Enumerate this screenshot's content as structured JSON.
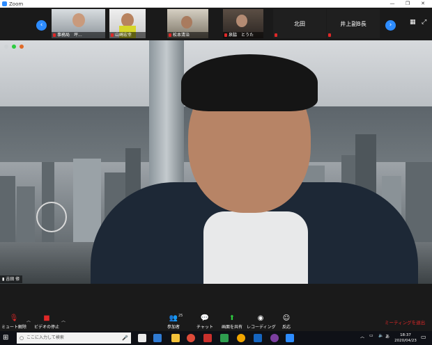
{
  "window": {
    "title": "Zoom"
  },
  "window_controls": {
    "minimize": "—",
    "maximize": "❐",
    "close": "✕"
  },
  "gallery": {
    "prev": "‹",
    "next": "›",
    "participants": [
      {
        "name": "事務局　坪..."
      },
      {
        "name": "山崎宏幸"
      },
      {
        "name": "松本清治"
      },
      {
        "name": "泉脇　とうた"
      },
      {
        "name": "北田",
        "display": "北田"
      },
      {
        "name": "井上副B長",
        "display": "井上副B長"
      }
    ]
  },
  "main": {
    "speaker_name": "吉田 修"
  },
  "toolbar": {
    "mute_label": "ミュート解除",
    "video_label": "ビデオの停止",
    "participants_label": "参加者",
    "participants_count": "25",
    "chat_label": "チャット",
    "share_label": "画面を共有",
    "record_label": "レコーディング",
    "reactions_label": "反応",
    "end_label": "ミーティングを退出"
  },
  "taskbar": {
    "search_placeholder": "ここに入力して検索",
    "time": "18:37",
    "date": "2020/04/23",
    "ime": "あ"
  },
  "colors": {
    "accent": "#2d8cff",
    "danger": "#e02828",
    "share": "#2ecc40"
  }
}
